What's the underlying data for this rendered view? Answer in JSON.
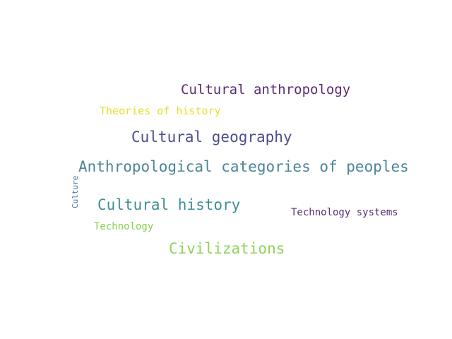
{
  "word_cloud": {
    "words": [
      {
        "text": "Cultural anthropology",
        "color": "#5a2d6e"
      },
      {
        "text": "Theories of history",
        "color": "#e3df2a"
      },
      {
        "text": "Cultural geography",
        "color": "#4b4f8c"
      },
      {
        "text": "Anthropological categories of peoples",
        "color": "#4b8498"
      },
      {
        "text": "Culture",
        "color": "#4b7698"
      },
      {
        "text": "Cultural history",
        "color": "#3f8d9a"
      },
      {
        "text": "Technology systems",
        "color": "#5b2f6f"
      },
      {
        "text": "Technology",
        "color": "#88d14e"
      },
      {
        "text": "Civilizations",
        "color": "#8fd35a"
      }
    ]
  }
}
